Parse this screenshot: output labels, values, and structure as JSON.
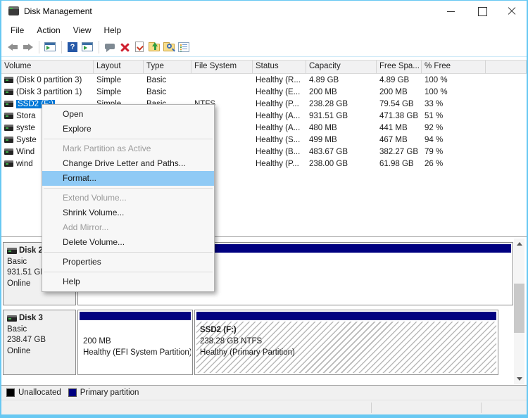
{
  "window": {
    "title": "Disk Management"
  },
  "menubar": [
    "File",
    "Action",
    "View",
    "Help"
  ],
  "toolbar": {
    "icons": [
      "back-arrow",
      "forward-arrow",
      "console-tree",
      "help",
      "console-detail",
      "action-pane",
      "delete-x",
      "check-document",
      "folder-up",
      "folder-search",
      "properties"
    ]
  },
  "table": {
    "columns": [
      "Volume",
      "Layout",
      "Type",
      "File System",
      "Status",
      "Capacity",
      "Free Spa...",
      "% Free"
    ],
    "rows": [
      {
        "volume": "(Disk 0 partition 3)",
        "layout": "Simple",
        "type": "Basic",
        "fs": "",
        "status": "Healthy (R...",
        "capacity": "4.89 GB",
        "free": "4.89 GB",
        "pct": "100 %",
        "selected": false
      },
      {
        "volume": "(Disk 3 partition 1)",
        "layout": "Simple",
        "type": "Basic",
        "fs": "",
        "status": "Healthy (E...",
        "capacity": "200 MB",
        "free": "200 MB",
        "pct": "100 %",
        "selected": false
      },
      {
        "volume": "SSD2 (F:)",
        "layout": "Simple",
        "type": "Basic",
        "fs": "NTFS",
        "status": "Healthy (P...",
        "capacity": "238.28 GB",
        "free": "79.54 GB",
        "pct": "33 %",
        "selected": true
      },
      {
        "volume": "Stora",
        "layout": "",
        "type": "",
        "fs": "",
        "status": "Healthy (A...",
        "capacity": "931.51 GB",
        "free": "471.38 GB",
        "pct": "51 %",
        "selected": false
      },
      {
        "volume": "syste",
        "layout": "",
        "type": "",
        "fs": "",
        "status": "Healthy (A...",
        "capacity": "480 MB",
        "free": "441 MB",
        "pct": "92 %",
        "selected": false
      },
      {
        "volume": "Syste",
        "layout": "",
        "type": "",
        "fs": "",
        "status": "Healthy (S...",
        "capacity": "499 MB",
        "free": "467 MB",
        "pct": "94 %",
        "selected": false
      },
      {
        "volume": "Wind",
        "layout": "",
        "type": "",
        "fs": "",
        "status": "Healthy (B...",
        "capacity": "483.67 GB",
        "free": "382.27 GB",
        "pct": "79 %",
        "selected": false
      },
      {
        "volume": "wind",
        "layout": "",
        "type": "",
        "fs": "",
        "status": "Healthy (P...",
        "capacity": "238.00 GB",
        "free": "61.98 GB",
        "pct": "26 %",
        "selected": false
      }
    ]
  },
  "context_menu": {
    "items": [
      {
        "label": "Open",
        "enabled": true,
        "highlighted": false
      },
      {
        "label": "Explore",
        "enabled": true,
        "highlighted": false
      },
      {
        "label": "Mark Partition as Active",
        "enabled": false,
        "highlighted": false
      },
      {
        "label": "Change Drive Letter and Paths...",
        "enabled": true,
        "highlighted": false
      },
      {
        "label": "Format...",
        "enabled": true,
        "highlighted": true
      },
      {
        "label": "Extend Volume...",
        "enabled": false,
        "highlighted": false
      },
      {
        "label": "Shrink Volume...",
        "enabled": true,
        "highlighted": false
      },
      {
        "label": "Add Mirror...",
        "enabled": false,
        "highlighted": false
      },
      {
        "label": "Delete Volume...",
        "enabled": true,
        "highlighted": false
      },
      {
        "label": "Properties",
        "enabled": true,
        "highlighted": false
      },
      {
        "label": "Help",
        "enabled": true,
        "highlighted": false
      }
    ]
  },
  "graph": {
    "disk2": {
      "name": "Disk 2",
      "type": "Basic",
      "size": "931.51 GB",
      "status": "Online"
    },
    "disk3": {
      "name": "Disk 3",
      "type": "Basic",
      "size": "238.47 GB",
      "status": "Online",
      "partitions": [
        {
          "size": "200 MB",
          "status": "Healthy (EFI System Partition)"
        },
        {
          "name": "SSD2  (F:)",
          "size_fs": "238.28 GB NTFS",
          "status": "Healthy (Primary Partition)",
          "selected": true
        }
      ]
    }
  },
  "legend": [
    {
      "label": "Unallocated",
      "color": "#000000"
    },
    {
      "label": "Primary partition",
      "color": "#000080"
    }
  ],
  "colors": {
    "selection": "#0078d7",
    "menu_highlight": "#8fcaf5",
    "partition_band": "#000080",
    "window_border": "#67c8f2"
  }
}
